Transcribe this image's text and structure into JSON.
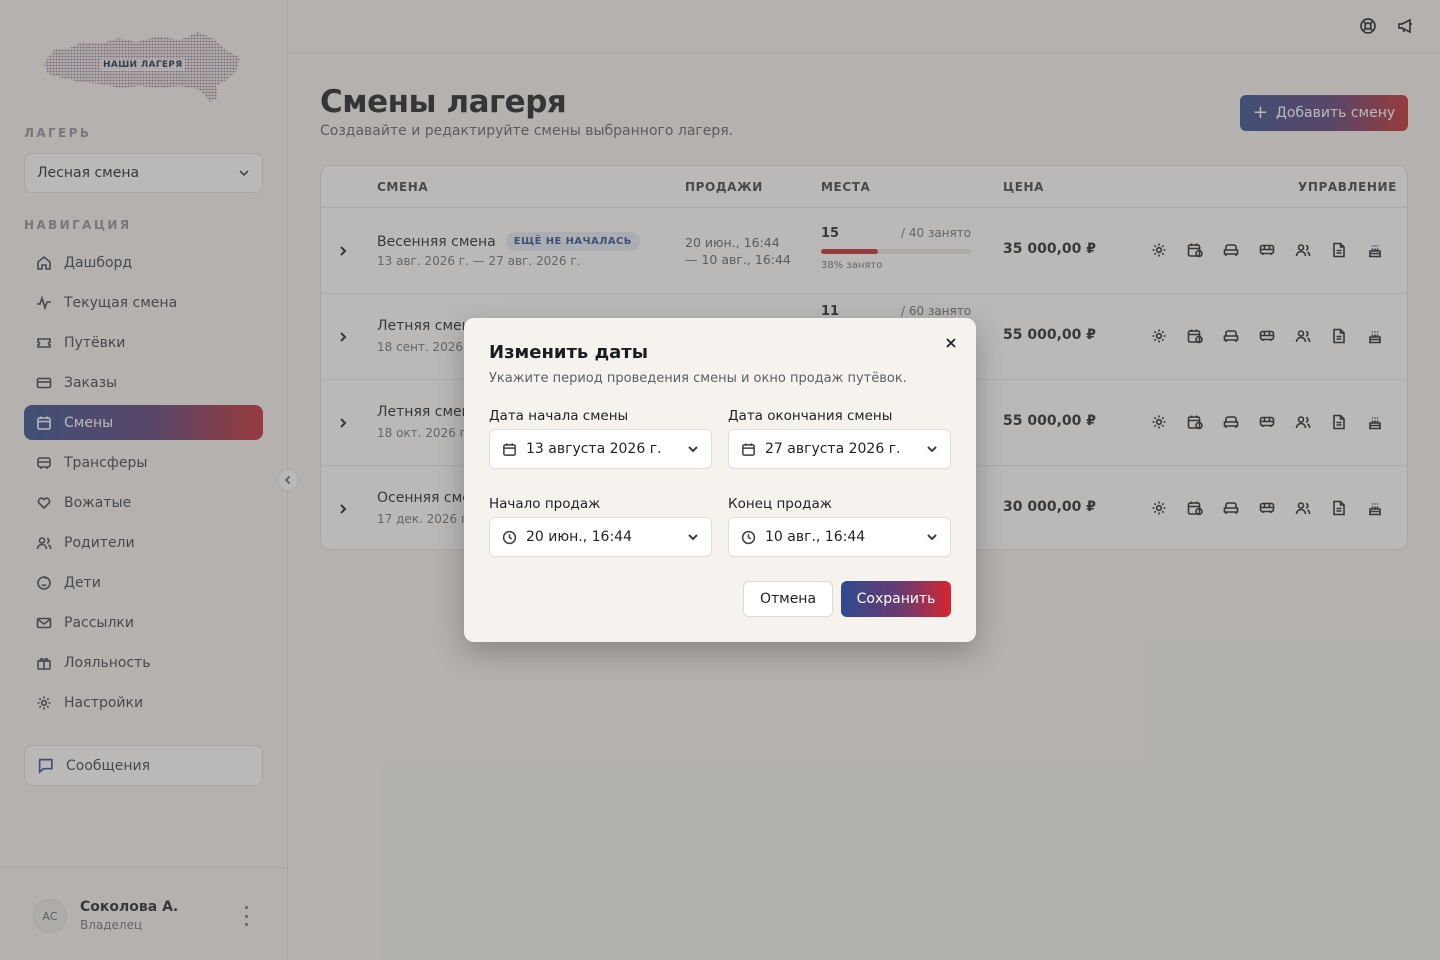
{
  "sidebar": {
    "logo_text": "НАШИ ЛАГЕРЯ",
    "camp_label": "ЛАГЕРЬ",
    "camp_selected": "Лесная смена",
    "nav_label": "НАВИГАЦИЯ",
    "items": [
      {
        "label": "Дашборд",
        "icon": "home-icon"
      },
      {
        "label": "Текущая смена",
        "icon": "activity-icon"
      },
      {
        "label": "Путёвки",
        "icon": "ticket-icon"
      },
      {
        "label": "Заказы",
        "icon": "card-icon"
      },
      {
        "label": "Смены",
        "icon": "calendar-icon",
        "active": true
      },
      {
        "label": "Трансферы",
        "icon": "bus-icon"
      },
      {
        "label": "Вожатые",
        "icon": "heart-hand-icon"
      },
      {
        "label": "Родители",
        "icon": "users-icon"
      },
      {
        "label": "Дети",
        "icon": "baby-icon"
      },
      {
        "label": "Рассылки",
        "icon": "mail-icon"
      },
      {
        "label": "Лояльность",
        "icon": "gift-icon"
      },
      {
        "label": "Настройки",
        "icon": "gear-icon"
      }
    ],
    "messages_label": "Сообщения",
    "user": {
      "initials": "АС",
      "name": "Соколова А.",
      "role": "Владелец"
    }
  },
  "header": {
    "title": "Смены лагеря",
    "subtitle": "Создавайте и редактируйте смены выбранного лагеря.",
    "add_button": "Добавить смену"
  },
  "table": {
    "columns": [
      "СМЕНА",
      "ПРОДАЖИ",
      "МЕСТА",
      "ЦЕНА",
      "УПРАВЛЕНИЕ"
    ],
    "rows": [
      {
        "name": "Весенняя смена",
        "badge": "ЕЩЁ НЕ НАЧАЛАСЬ",
        "dates": "13 авг. 2026 г. — 27 авг. 2026 г.",
        "sales_from": "20 июн., 16:44",
        "sales_to": "— 10 авг., 16:44",
        "seats_taken": "15",
        "seats_total": "/ 40 занято",
        "occupancy_pct": 38,
        "occupancy_label": "38% занято",
        "price": "35 000,00 ₽"
      },
      {
        "name": "Летняя смена",
        "dates": "18 сент. 2026 г.",
        "seats_taken": "11",
        "seats_total": "/ 60 занято",
        "price": "55 000,00 ₽"
      },
      {
        "name": "Летняя смена",
        "dates": "18 окт. 2026 г. -",
        "price": "55 000,00 ₽"
      },
      {
        "name": "Осенняя смена",
        "dates": "17 дек. 2026 г. -",
        "price": "30 000,00 ₽"
      }
    ]
  },
  "modal": {
    "title": "Изменить даты",
    "description": "Укажите период проведения смены и окно продаж путёвок.",
    "start_label": "Дата начала смены",
    "start_value": "13 августа 2026 г.",
    "end_label": "Дата окончания смены",
    "end_value": "27 августа 2026 г.",
    "sales_start_label": "Начало продаж",
    "sales_start_value": "20 июн., 16:44",
    "sales_end_label": "Конец продаж",
    "sales_end_value": "10 авг., 16:44",
    "cancel": "Отмена",
    "save": "Сохранить"
  },
  "colors": {
    "accent_blue": "#2f4a8f",
    "accent_red": "#c2262d",
    "badge_bg": "#e3edf7"
  }
}
